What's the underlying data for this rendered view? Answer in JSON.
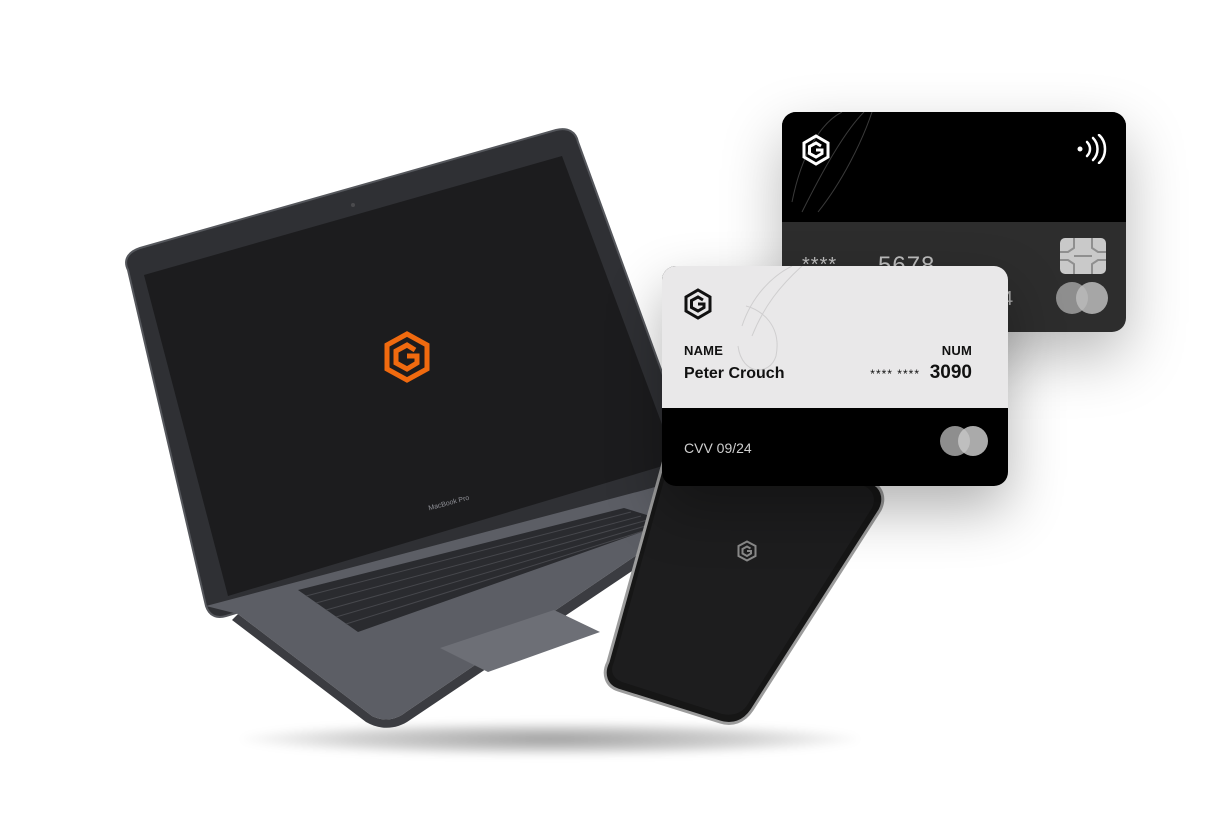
{
  "laptop": {
    "brand_label": "MacBook Pro",
    "logo_color": "#f06a0f"
  },
  "phone": {
    "logo_color": "#8a8a8a"
  },
  "card_back": {
    "masked_stars": "****",
    "number_partial": "5678",
    "stray_digit": "4",
    "contactless_icon": "contactless-icon",
    "chip_icon": "chip-icon",
    "network_icon": "mastercard-icon"
  },
  "card_front": {
    "name_label": "NAME",
    "holder_name": "Peter Crouch",
    "num_label": "NUM",
    "masked_number": "**** ****",
    "last_digits": "3090",
    "cvv_text": "CVV 09/24",
    "network_icon": "mastercard-icon"
  },
  "colors": {
    "accent": "#f06a0f",
    "card_dark": "#000000",
    "card_light": "#e9e8e9",
    "card_mid": "#2d2d2d"
  }
}
